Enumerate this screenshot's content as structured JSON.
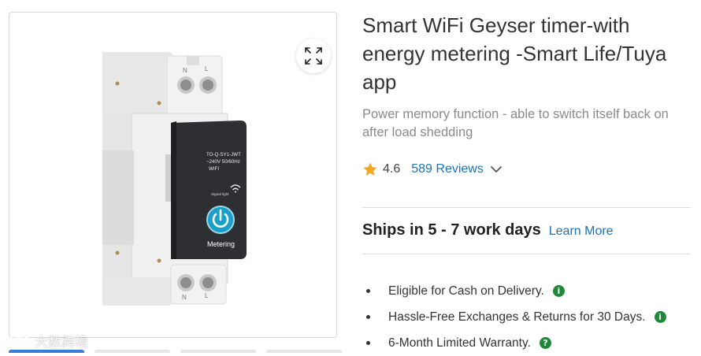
{
  "product": {
    "title": "Smart WiFi Geyser timer-with energy metering -Smart Life/Tuya app",
    "subtitle": "Power memory function - able to switch itself back on after load shedding",
    "rating": "4.6",
    "reviews_label": "589 Reviews"
  },
  "shipping": {
    "text": "Ships in 5 - 7 work days",
    "learn_more": "Learn More"
  },
  "features": [
    {
      "text": "Eligible for Cash on Delivery.",
      "icon": "info-icon",
      "glyph": "i"
    },
    {
      "text": "Hassle-Free Exchanges & Returns for 30 Days.",
      "icon": "info-icon",
      "glyph": "i"
    },
    {
      "text": "6-Month Limited Warranty.",
      "icon": "help-icon",
      "glyph": "?"
    }
  ],
  "device": {
    "spec_line1": "TO-Q-SY1-JWT",
    "spec_line2": "~240V 50/60Hz",
    "spec_line3": "WIFI",
    "signal_label": "Signal light",
    "button_label": "Metering",
    "terminal_top_n": "N",
    "terminal_top_l": "L",
    "terminal_bottom_n": "N",
    "terminal_bottom_l": "L"
  },
  "watermark": "大数跨境",
  "colors": {
    "link": "#1a73b8",
    "star": "#f5a623",
    "badge": "#1e8a38",
    "device_panel": "#2d2f33",
    "power_ring": "#1aa0c8",
    "thumb_active": "#3a7bd5"
  }
}
